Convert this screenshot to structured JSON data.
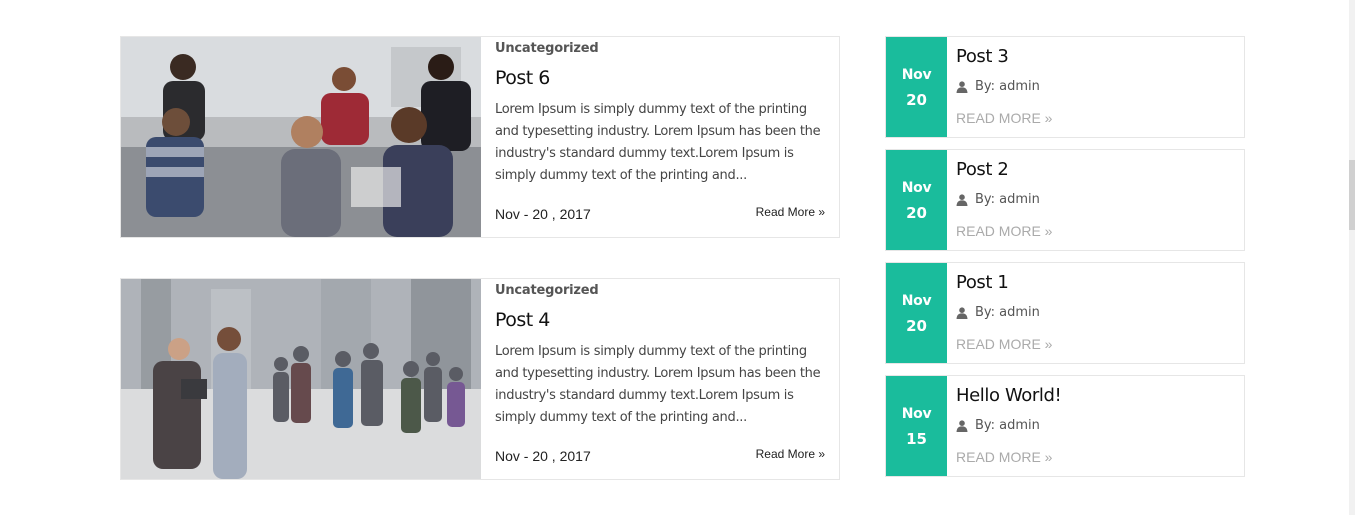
{
  "posts": [
    {
      "category": "Uncategorized",
      "title": "Post 6",
      "excerpt": "Lorem Ipsum is simply dummy text of the printing and typesetting industry. Lorem Ipsum has been the industry's standard dummy text.Lorem Ipsum is simply dummy text of the printing and...",
      "date": "Nov - 20 , 2017",
      "read_more": "Read More »",
      "image": "office-meeting-photo"
    },
    {
      "category": "Uncategorized",
      "title": "Post 4",
      "excerpt": "Lorem Ipsum is simply dummy text of the printing and typesetting industry. Lorem Ipsum has been the industry's standard dummy text.Lorem Ipsum is simply dummy text of the printing and...",
      "date": "Nov - 20 , 2017",
      "read_more": "Read More »",
      "image": "business-people-walking-photo"
    }
  ],
  "recent_posts": [
    {
      "month": "Nov",
      "day": "20",
      "title": "Post 3",
      "author": "By: admin",
      "read_more": "READ MORE »"
    },
    {
      "month": "Nov",
      "day": "20",
      "title": "Post 2",
      "author": "By: admin",
      "read_more": "READ MORE »"
    },
    {
      "month": "Nov",
      "day": "20",
      "title": "Post 1",
      "author": "By: admin",
      "read_more": "READ MORE »"
    },
    {
      "month": "Nov",
      "day": "15",
      "title": "Hello World!",
      "author": "By: admin",
      "read_more": "READ MORE »"
    }
  ],
  "colors": {
    "accent": "#1abc9c",
    "muted_link": "#aaaaaa"
  },
  "icons": {
    "author": "user-icon"
  }
}
